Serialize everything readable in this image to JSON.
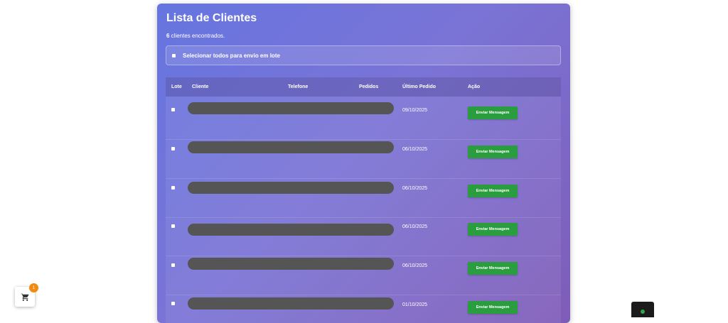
{
  "header": {
    "title": "Lista de Clientes",
    "count_number": "6",
    "count_suffix": " clientes encontrados."
  },
  "select_all": {
    "label": "Selecionar todos para envio em lote"
  },
  "table": {
    "columns": [
      "Lote",
      "Cliente",
      "Telefone",
      "Pedidos",
      "Último Pedido",
      "Ação"
    ],
    "rows": [
      {
        "last_order": "09/10/2025",
        "action": "Enviar Mensagem"
      },
      {
        "last_order": "06/10/2025",
        "action": "Enviar Mensagem"
      },
      {
        "last_order": "06/10/2025",
        "action": "Enviar Mensagem"
      },
      {
        "last_order": "06/10/2025",
        "action": "Enviar Mensagem"
      },
      {
        "last_order": "06/10/2025",
        "action": "Enviar Mensagem"
      },
      {
        "last_order": "01/10/2025",
        "action": "Enviar Mensagem"
      }
    ]
  },
  "cart": {
    "badge_count": "1",
    "icon": "cart-icon"
  },
  "colors": {
    "panel_start": "#6675e0",
    "panel_end": "#7f5cb8",
    "button_green": "#2a9d3e",
    "badge_orange": "#f28a11",
    "redaction": "#555555"
  }
}
